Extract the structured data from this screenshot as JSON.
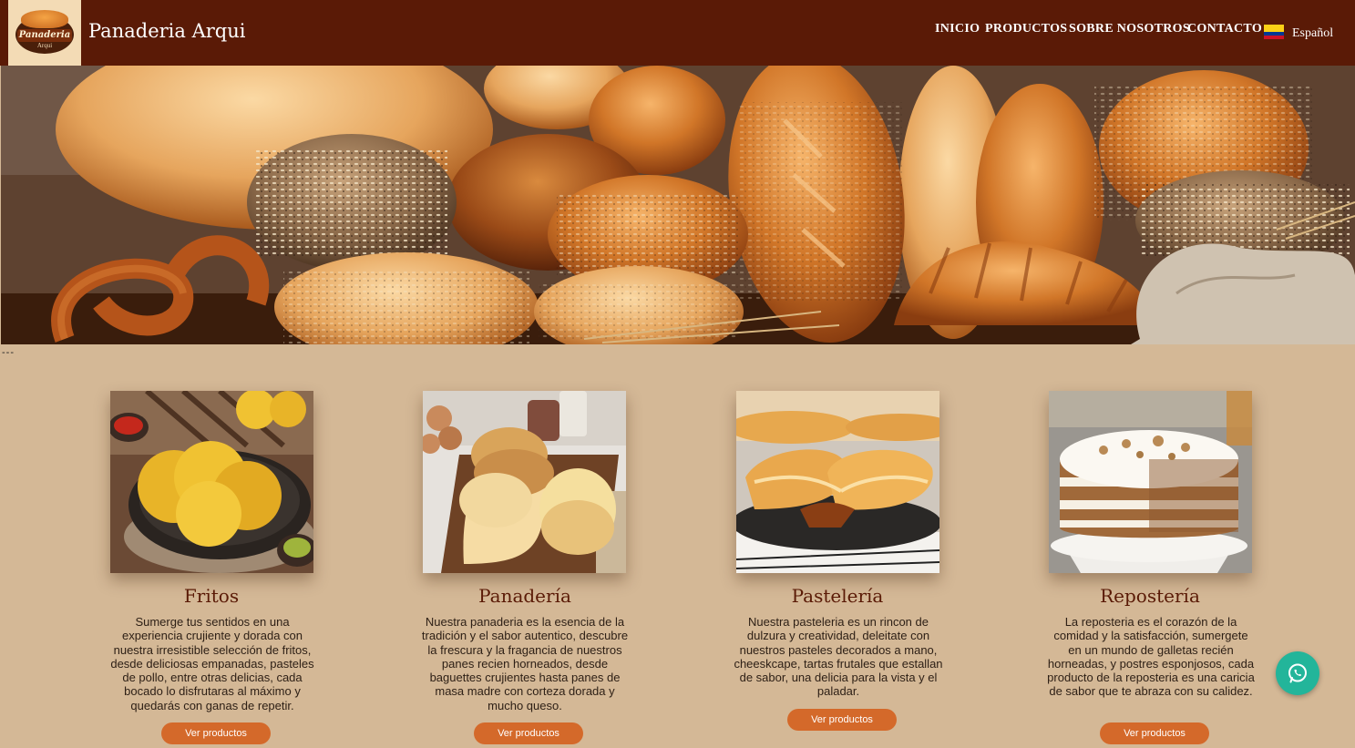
{
  "brand": {
    "name": "Panaderia Arqui",
    "logo_text": "Panaderia",
    "logo_subtext": "Arqui"
  },
  "nav": {
    "items": [
      "INICIO",
      "PRODUCTOS",
      "SOBRE NOSOTROS",
      "CONTACTO"
    ],
    "language": "Español",
    "flag": "colombia-flag-icon"
  },
  "separator": "---",
  "cards": [
    {
      "title": "Fritos",
      "description": "Sumerge tus sentidos en una experiencia crujiente y dorada con nuestra irresistible selección de fritos, desde deliciosas empanadas, pasteles de pollo, entre otras delicias, cada bocado lo disfrutaras al máximo y quedarás con ganas de repetir.",
      "button": "Ver productos"
    },
    {
      "title": "Panadería",
      "description": "Nuestra panaderia es la esencia de la tradición y el sabor autentico, descubre la frescura y la fragancia de nuestros panes recien horneados, desde baguettes crujientes hasta panes de masa madre con corteza dorada y mucho queso.",
      "button": "Ver productos"
    },
    {
      "title": "Pastelería",
      "description": "Nuestra pasteleria es un rincon de dulzura y creatividad, deleitate con nuestros pasteles decorados a mano, cheeskcape, tartas frutales que estallan de sabor, una delicia para la vista y el paladar.",
      "button": "Ver productos"
    },
    {
      "title": "Repostería",
      "description": "La reposteria es el corazón de la comidad y la satisfacción, sumergete en un mundo de galletas recién horneadas, y postres esponjosos, cada producto de la reposteria es una caricia de sabor que te abraza con su calidez.",
      "button": "Ver productos"
    }
  ],
  "colors": {
    "header": "#5a1a06",
    "page_background": "#d4b896",
    "button": "#d4692a",
    "whatsapp": "#23b59a"
  },
  "icons": {
    "whatsapp": "whatsapp-icon"
  }
}
